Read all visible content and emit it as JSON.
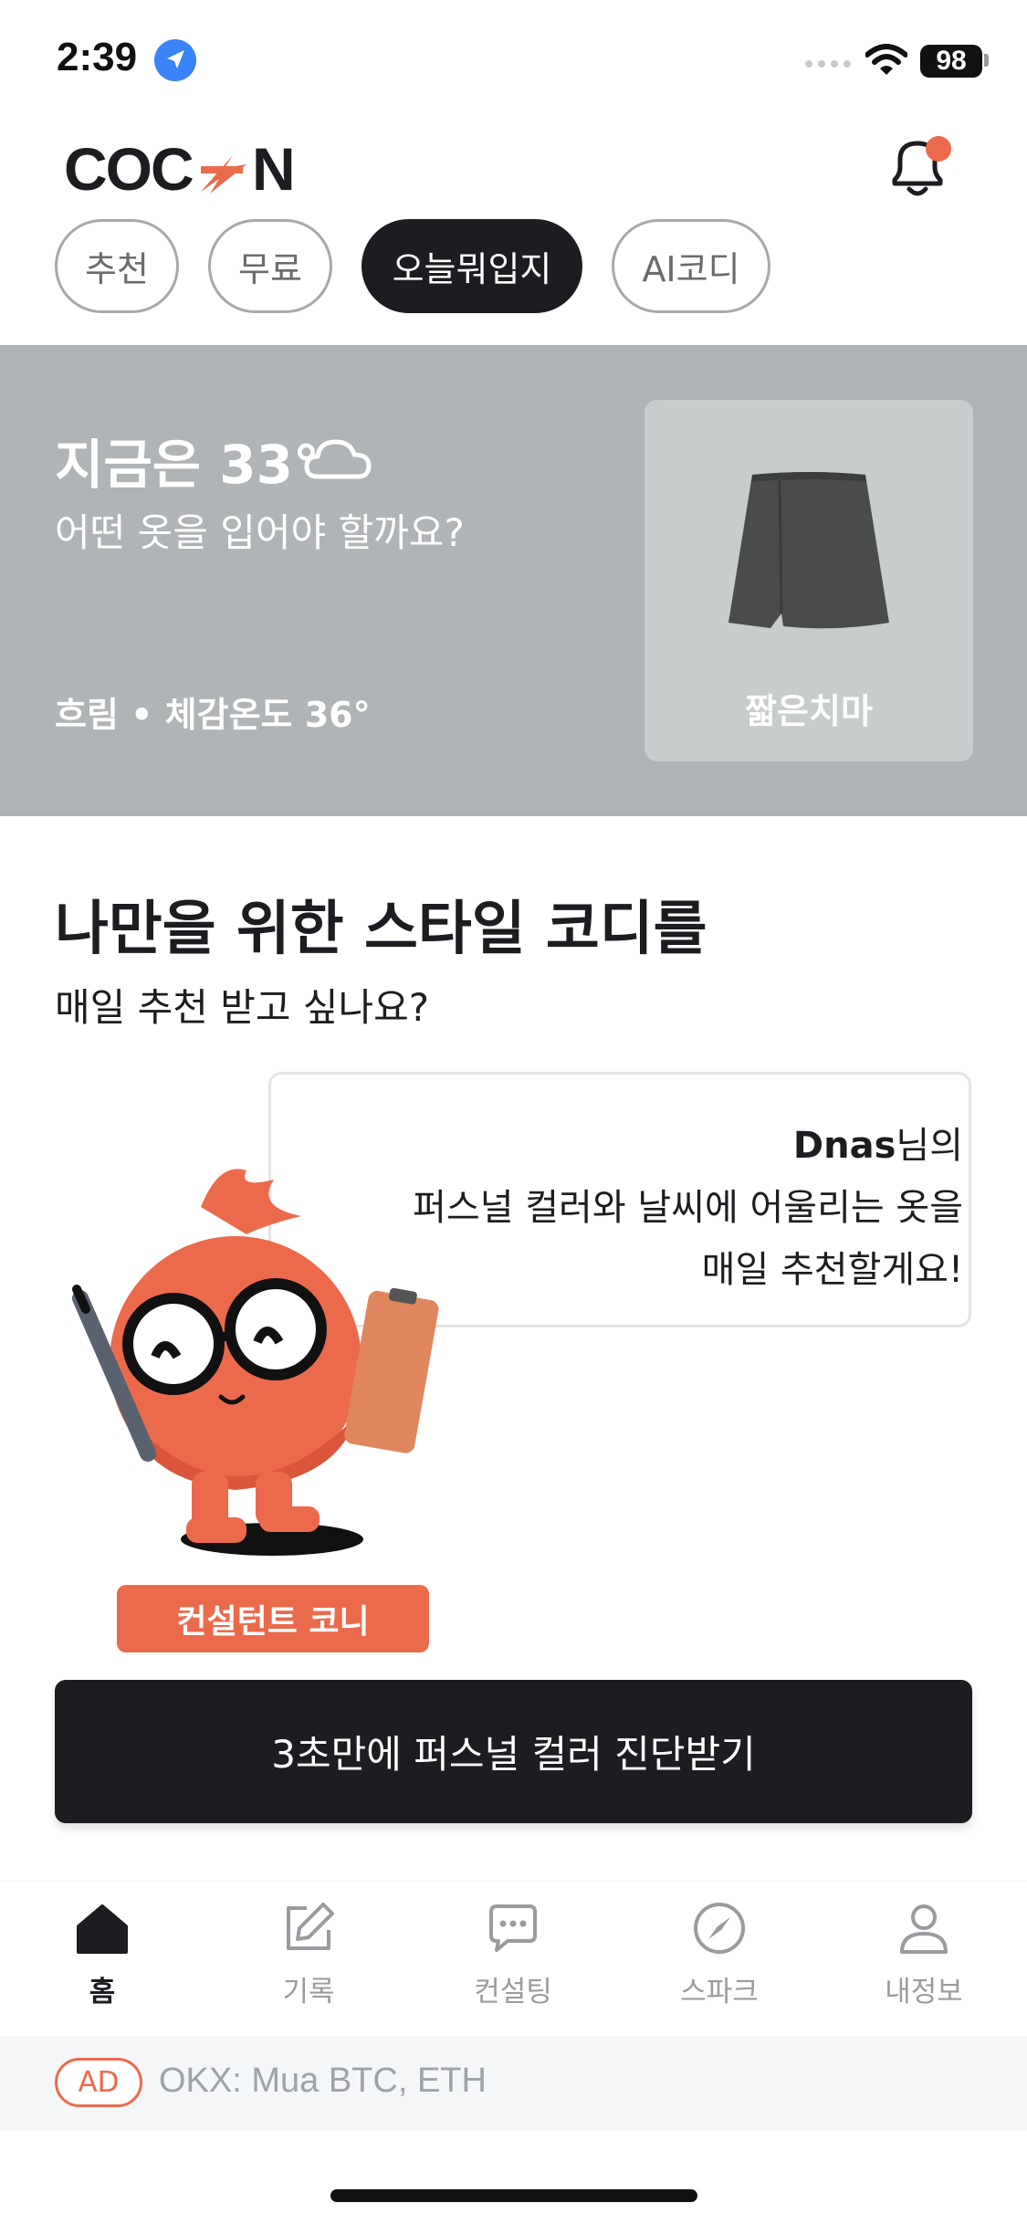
{
  "status_bar": {
    "time": "2:39",
    "battery": "98"
  },
  "header": {
    "logo_text": "COCON"
  },
  "chips": [
    {
      "label": "추천",
      "active": false
    },
    {
      "label": "무료",
      "active": false
    },
    {
      "label": "오늘뭐입지",
      "active": true
    },
    {
      "label": "AI코디",
      "active": false
    }
  ],
  "weather": {
    "title": "지금은 33°",
    "icon": "cloud-icon",
    "question": "어떤 옷을 입어야 할까요?",
    "detail": "흐림 • 체감온도 36°",
    "recommendation": "짧은치마"
  },
  "promo": {
    "title": "나만을 위한 스타일 코디를",
    "subtitle": "매일 추천 받고 싶나요?",
    "bubble": {
      "user_name": "Dnas",
      "line1_suffix": "님의",
      "line2": "퍼스널 컬러와 날씨에 어울리는 옷을",
      "line3": "매일 추천할게요!"
    },
    "consultant_label": "컨설턴트 코니",
    "cta_label": "3초만에 퍼스널 컬러 진단받기"
  },
  "tabs": [
    {
      "label": "홈",
      "icon": "home-icon",
      "active": true
    },
    {
      "label": "기록",
      "icon": "edit-icon",
      "active": false
    },
    {
      "label": "컨설팅",
      "icon": "chat-icon",
      "active": false
    },
    {
      "label": "스파크",
      "icon": "compass-icon",
      "active": false
    },
    {
      "label": "내정보",
      "icon": "user-icon",
      "active": false
    }
  ],
  "ad": {
    "badge": "AD",
    "text": "OKX: Mua BTC, ETH"
  },
  "colors": {
    "accent": "#ec6a4c",
    "dark": "#1c1c21",
    "weather_bg": "#b0b4b6"
  }
}
